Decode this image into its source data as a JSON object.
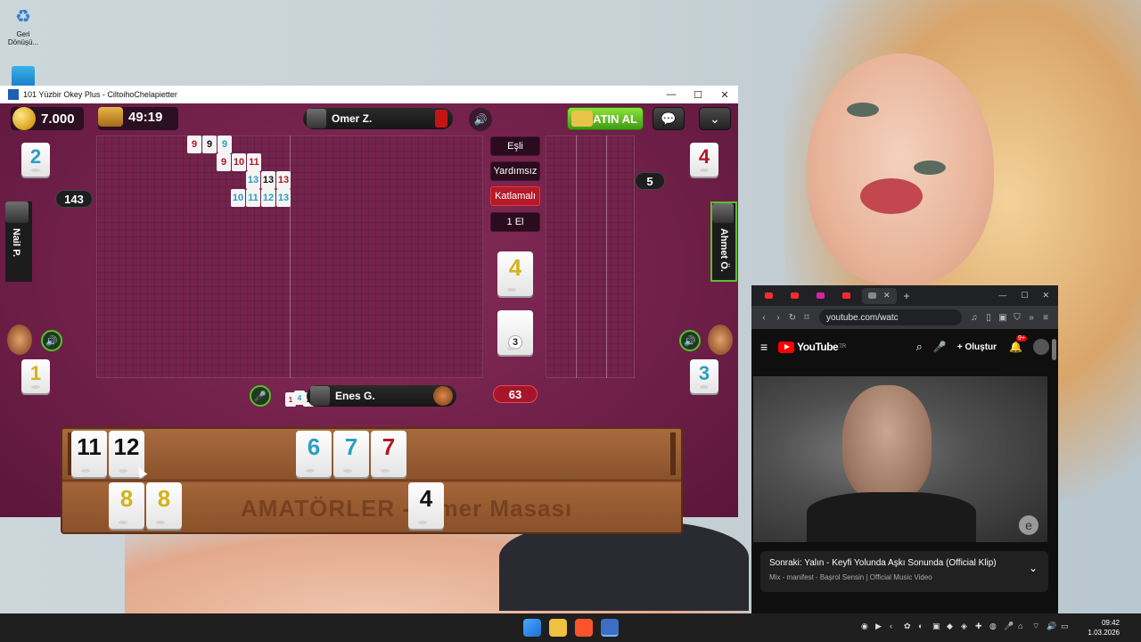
{
  "desktop": {
    "icons": [
      {
        "label": "Geri Dönüşü..."
      },
      {
        "label": ""
      }
    ]
  },
  "game_window": {
    "title": "101 Yüzbir Okey Plus - CiltoihoChelapietter",
    "controls": {
      "minimize": "—",
      "maximize": "☐",
      "close": "✕"
    },
    "hud": {
      "coins": "7.000",
      "timer": "49:19",
      "buy_label": "SATIN AL"
    },
    "players": {
      "top": {
        "name": "Omer Z."
      },
      "left": {
        "name": "Nail P.",
        "score": "143"
      },
      "right": {
        "name": "Ahmet Ö."
      },
      "bottom": {
        "name": "Enes G.",
        "score": "63"
      }
    },
    "indicators": {
      "top_left_tile": "2",
      "top_right_tile": "4",
      "top_right_count": "5",
      "bottom_left_tile": "1",
      "bottom_right_tile": "3",
      "center_indicator": "4",
      "deck_count": "3"
    },
    "modes": [
      "Eşli",
      "Yardımsız",
      "Katlamalı",
      "1 El"
    ],
    "active_mode": "Katlamalı",
    "meld_rows": [
      {
        "tiles": [
          {
            "v": "9",
            "c": "red"
          },
          {
            "v": "9",
            "c": "black"
          },
          {
            "v": "9",
            "c": "blue"
          }
        ]
      },
      {
        "tiles": [
          {
            "v": "9",
            "c": "red"
          },
          {
            "v": "10",
            "c": "red"
          },
          {
            "v": "11",
            "c": "red"
          }
        ]
      },
      {
        "tiles": [
          {
            "v": "13",
            "c": "blue"
          },
          {
            "v": "13",
            "c": "black"
          },
          {
            "v": "13",
            "c": "red"
          }
        ]
      },
      {
        "tiles": [
          {
            "v": "10",
            "c": "blue"
          },
          {
            "v": "11",
            "c": "blue"
          },
          {
            "v": "12",
            "c": "blue"
          },
          {
            "v": "13",
            "c": "blue"
          }
        ]
      }
    ],
    "mini_hand": [
      "1",
      "4",
      "2"
    ],
    "rack": {
      "top_row": [
        {
          "v": "11",
          "c": "black"
        },
        {
          "v": "12",
          "c": "black"
        },
        {
          "v": "6",
          "c": "blue"
        },
        {
          "v": "7",
          "c": "blue"
        },
        {
          "v": "7",
          "c": "red"
        }
      ],
      "bottom_row": [
        {
          "v": "8",
          "c": "yellow"
        },
        {
          "v": "8",
          "c": "yellow"
        },
        {
          "v": "4",
          "c": "black"
        }
      ],
      "watermark": "AMATÖRLER - Omer Masası"
    }
  },
  "browser": {
    "tabs": [
      "",
      "",
      "",
      "",
      ""
    ],
    "address": "youtube.com/watc",
    "youtube": {
      "logo_text": "YouTube",
      "logo_suffix": "TR",
      "create_label": "Oluştur",
      "notif_count": "9+",
      "up_next_title": "Sonraki: Yalın - Keyfi Yolunda Aşkı Sonunda (Official Klip)",
      "up_next_sub": "Mix - manifest - Başrol Sensin | Official Music Video"
    }
  },
  "taskbar": {
    "time": "09:42",
    "date": "1.03.2026"
  },
  "colors": {
    "tile_red": "#b3152a",
    "tile_blue": "#2a9fc4",
    "tile_black": "#111111",
    "tile_yellow": "#d4b21a",
    "board": "#73234c",
    "accent_green": "#5cc02a"
  }
}
